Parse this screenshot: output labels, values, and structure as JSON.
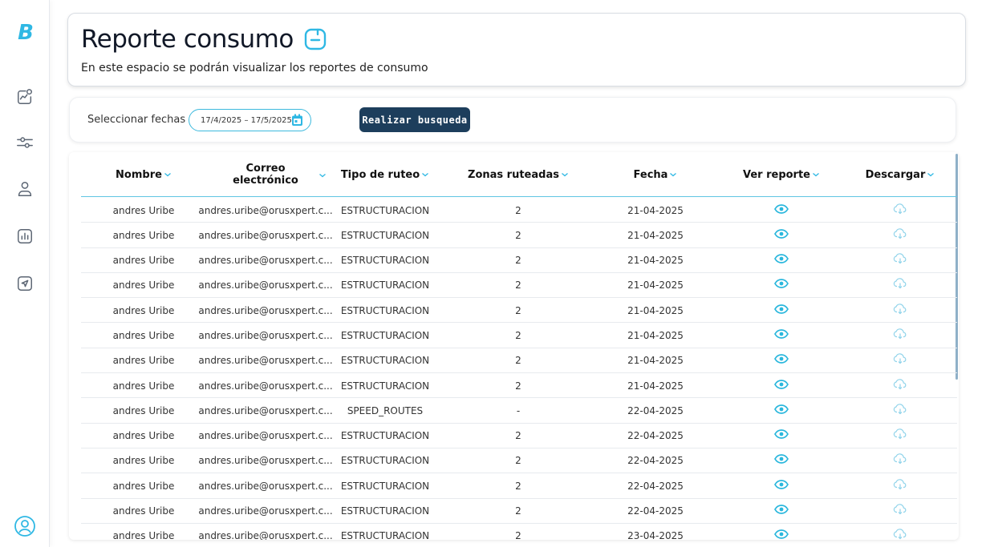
{
  "sidebar": {
    "logo": "B",
    "items": [
      {
        "icon": "analytics-icon"
      },
      {
        "icon": "sliders-icon"
      },
      {
        "icon": "user-icon"
      },
      {
        "icon": "bar-chart-icon"
      },
      {
        "icon": "send-icon"
      }
    ],
    "profile_icon": "user-circle-icon"
  },
  "header": {
    "title": "Reporte consumo",
    "subtitle": "En este espacio se podrán visualizar los reportes de consumo"
  },
  "filters": {
    "label": "Seleccionar fechas",
    "date_range": "17/4/2025 – 17/5/2025",
    "search_button": "Realizar busqueda"
  },
  "table": {
    "columns": [
      {
        "label": "Nombre"
      },
      {
        "label_line1": "Correo",
        "label_line2": "electrónico"
      },
      {
        "label": "Tipo de ruteo"
      },
      {
        "label": "Zonas ruteadas"
      },
      {
        "label": "Fecha"
      },
      {
        "label": "Ver reporte"
      },
      {
        "label": "Descargar"
      }
    ],
    "rows": [
      {
        "name": "andres Uribe",
        "email": "andres.uribe@orusxpert.c...",
        "type": "ESTRUCTURACION",
        "zones": "2",
        "date": "21-04-2025"
      },
      {
        "name": "andres Uribe",
        "email": "andres.uribe@orusxpert.c...",
        "type": "ESTRUCTURACION",
        "zones": "2",
        "date": "21-04-2025"
      },
      {
        "name": "andres Uribe",
        "email": "andres.uribe@orusxpert.c...",
        "type": "ESTRUCTURACION",
        "zones": "2",
        "date": "21-04-2025"
      },
      {
        "name": "andres Uribe",
        "email": "andres.uribe@orusxpert.c...",
        "type": "ESTRUCTURACION",
        "zones": "2",
        "date": "21-04-2025"
      },
      {
        "name": "andres Uribe",
        "email": "andres.uribe@orusxpert.c...",
        "type": "ESTRUCTURACION",
        "zones": "2",
        "date": "21-04-2025"
      },
      {
        "name": "andres Uribe",
        "email": "andres.uribe@orusxpert.c...",
        "type": "ESTRUCTURACION",
        "zones": "2",
        "date": "21-04-2025"
      },
      {
        "name": "andres Uribe",
        "email": "andres.uribe@orusxpert.c...",
        "type": "ESTRUCTURACION",
        "zones": "2",
        "date": "21-04-2025"
      },
      {
        "name": "andres Uribe",
        "email": "andres.uribe@orusxpert.c...",
        "type": "ESTRUCTURACION",
        "zones": "2",
        "date": "21-04-2025"
      },
      {
        "name": "andres Uribe",
        "email": "andres.uribe@orusxpert.c...",
        "type": "SPEED_ROUTES",
        "zones": "-",
        "date": "22-04-2025"
      },
      {
        "name": "andres Uribe",
        "email": "andres.uribe@orusxpert.c...",
        "type": "ESTRUCTURACION",
        "zones": "2",
        "date": "22-04-2025"
      },
      {
        "name": "andres Uribe",
        "email": "andres.uribe@orusxpert.c...",
        "type": "ESTRUCTURACION",
        "zones": "2",
        "date": "22-04-2025"
      },
      {
        "name": "andres Uribe",
        "email": "andres.uribe@orusxpert.c...",
        "type": "ESTRUCTURACION",
        "zones": "2",
        "date": "22-04-2025"
      },
      {
        "name": "andres Uribe",
        "email": "andres.uribe@orusxpert.c...",
        "type": "ESTRUCTURACION",
        "zones": "2",
        "date": "22-04-2025"
      },
      {
        "name": "andres Uribe",
        "email": "andres.uribe@orusxpert.c...",
        "type": "ESTRUCTURACION",
        "zones": "2",
        "date": "23-04-2025"
      }
    ]
  },
  "colors": {
    "accent": "#2fb8e4",
    "button_bg": "#1d3e5c",
    "eye_icon": "#2ab7dd",
    "download_icon": "#8fd3ea"
  }
}
